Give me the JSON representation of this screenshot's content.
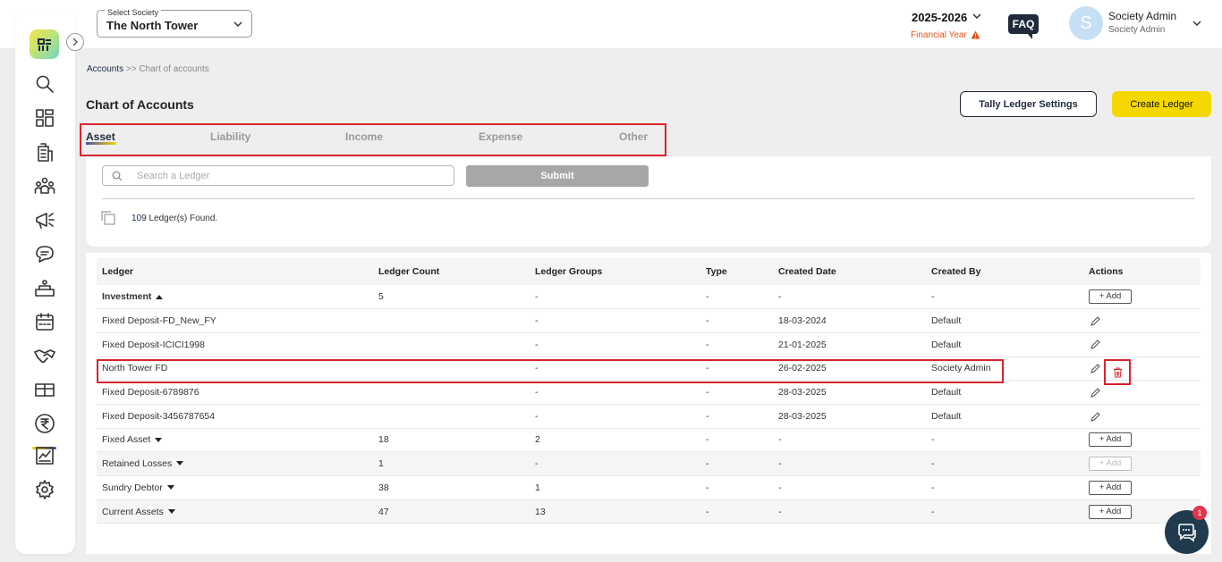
{
  "header": {
    "society_legend": "Select Society",
    "society_value": "The North Tower",
    "financial_year": "2025-2026",
    "financial_year_label": "Financial Year",
    "faq_label": "FAQ",
    "avatar_initial": "S",
    "user_name": "Society Admin",
    "user_role": "Society Admin"
  },
  "breadcrumb": {
    "root": "Accounts",
    "separator": ">>",
    "current": "Chart of accounts"
  },
  "page": {
    "title": "Chart of Accounts",
    "tally_button": "Tally Ledger Settings",
    "create_button": "Create Ledger"
  },
  "tabs": [
    {
      "label": "Asset",
      "active": true
    },
    {
      "label": "Liability",
      "active": false
    },
    {
      "label": "Income",
      "active": false
    },
    {
      "label": "Expense",
      "active": false
    },
    {
      "label": "Other",
      "active": false
    }
  ],
  "search": {
    "placeholder": "Search a Ledger",
    "value": "",
    "submit_label": "Submit",
    "found_count": "109",
    "found_text": "Ledger(s) Found."
  },
  "table": {
    "headers": [
      "Ledger",
      "Ledger Count",
      "Ledger Groups",
      "Type",
      "Created Date",
      "Created By",
      "Actions"
    ],
    "add_label": "+ Add",
    "rows": [
      {
        "kind": "group",
        "ledger": "Investment",
        "count": "5",
        "groups": "-",
        "type": "-",
        "date": "-",
        "by": "-",
        "expanded": true
      },
      {
        "kind": "child",
        "ledger": "Fixed Deposit-FD_New_FY",
        "count": "",
        "groups": "-",
        "type": "-",
        "date": "18-03-2024",
        "by": "Default"
      },
      {
        "kind": "child",
        "ledger": "Fixed Deposit-ICICI1998",
        "count": "",
        "groups": "-",
        "type": "-",
        "date": "21-01-2025",
        "by": "Default"
      },
      {
        "kind": "child",
        "ledger": "North Tower FD",
        "count": "",
        "groups": "-",
        "type": "-",
        "date": "26-02-2025",
        "by": "Society Admin"
      },
      {
        "kind": "child",
        "ledger": "Fixed Deposit-6789876",
        "count": "",
        "groups": "-",
        "type": "-",
        "date": "28-03-2025",
        "by": "Default"
      },
      {
        "kind": "child",
        "ledger": "Fixed Deposit-3456787654",
        "count": "",
        "groups": "-",
        "type": "-",
        "date": "28-03-2025",
        "by": "Default"
      },
      {
        "kind": "group",
        "ledger": "Fixed Asset",
        "count": "18",
        "groups": "2",
        "type": "-",
        "date": "-",
        "by": "-"
      },
      {
        "kind": "group",
        "ledger": "Retained Losses",
        "count": "1",
        "groups": "-",
        "type": "-",
        "date": "-",
        "by": "-"
      },
      {
        "kind": "group",
        "ledger": "Sundry Debtor",
        "count": "38",
        "groups": "1",
        "type": "-",
        "date": "-",
        "by": "-"
      },
      {
        "kind": "group",
        "ledger": "Current Assets",
        "count": "47",
        "groups": "13",
        "type": "-",
        "date": "-",
        "by": "-"
      }
    ]
  },
  "chat": {
    "badge": "1"
  },
  "colors": {
    "accent_yellow": "#f5d800",
    "navy": "#1f2a3a",
    "highlight_red": "#d9232d",
    "fy_orange": "#e2541b"
  }
}
